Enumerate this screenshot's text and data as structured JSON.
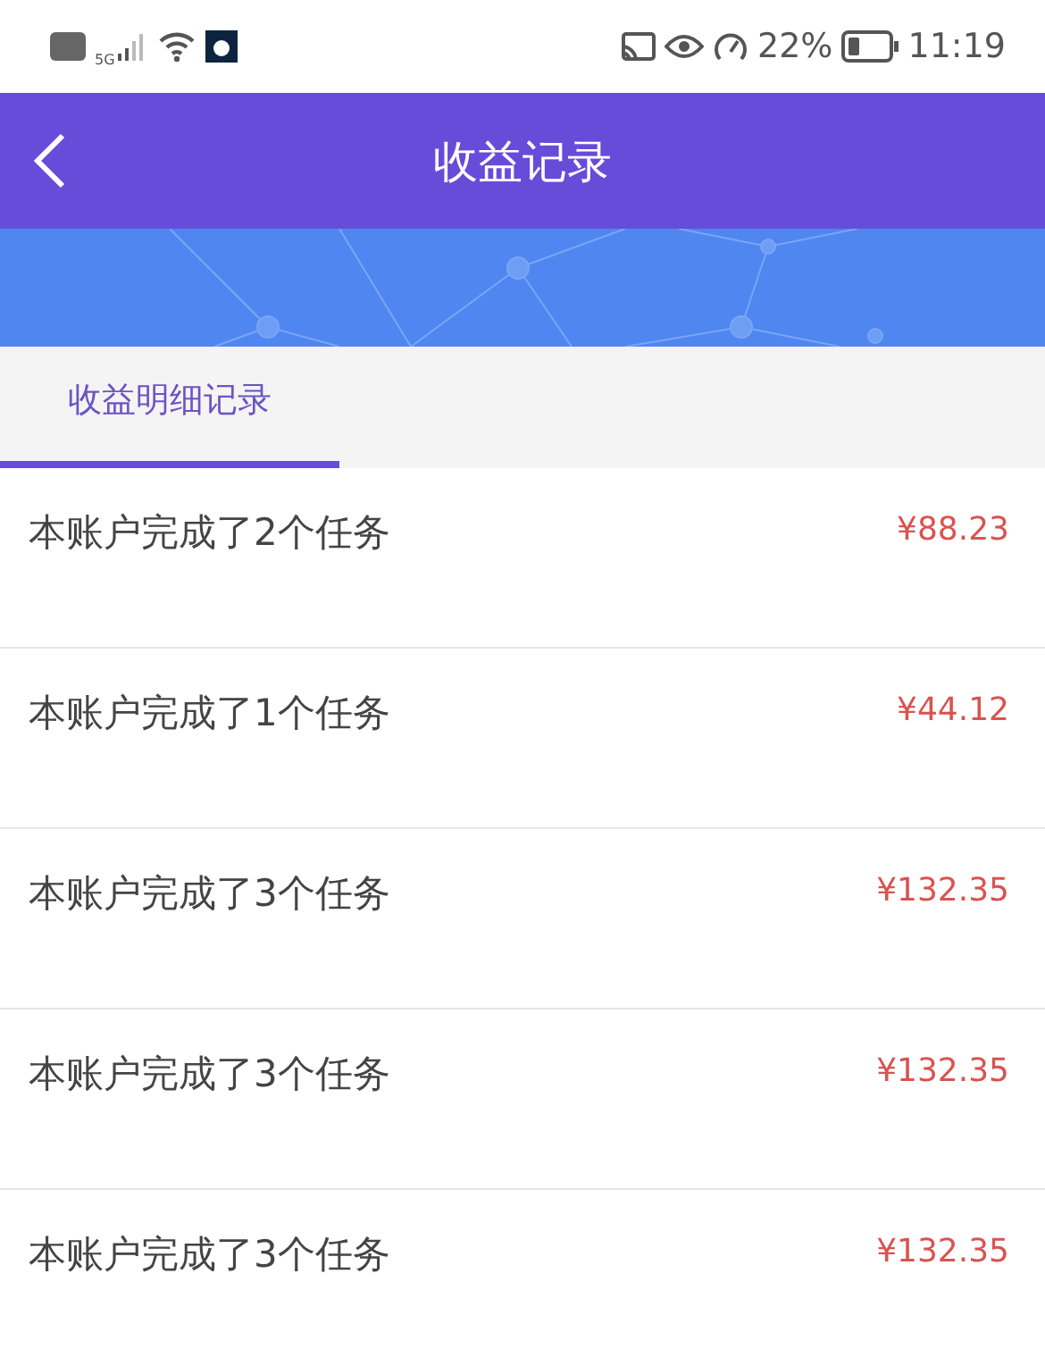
{
  "status_bar": {
    "network": "5G",
    "battery_percent": "22%",
    "time": "11:19"
  },
  "header": {
    "title": "收益记录"
  },
  "tabs": [
    {
      "label": "收益明细记录",
      "selected": true
    }
  ],
  "records": [
    {
      "description": "本账户完成了2个任务",
      "amount": "¥88.23"
    },
    {
      "description": "本账户完成了1个任务",
      "amount": "¥44.12"
    },
    {
      "description": "本账户完成了3个任务",
      "amount": "¥132.35"
    },
    {
      "description": "本账户完成了3个任务",
      "amount": "¥132.35"
    },
    {
      "description": "本账户完成了3个任务",
      "amount": "¥132.35"
    }
  ]
}
